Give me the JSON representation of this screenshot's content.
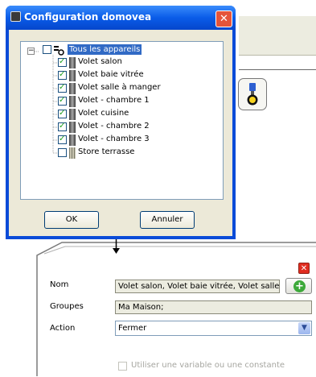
{
  "dialog": {
    "title": "Configuration domovea",
    "tree": {
      "root": {
        "label": "Tous les appareils",
        "checked": false
      },
      "items": [
        {
          "label": "Volet salon",
          "checked": true,
          "icon": "shutter-icon"
        },
        {
          "label": "Volet baie vitrée",
          "checked": true,
          "icon": "shutter-icon"
        },
        {
          "label": "Volet salle à manger",
          "checked": true,
          "icon": "shutter-icon"
        },
        {
          "label": "Volet - chambre 1",
          "checked": true,
          "icon": "shutter-icon"
        },
        {
          "label": "Volet cuisine",
          "checked": true,
          "icon": "shutter-icon"
        },
        {
          "label": "Volet - chambre 2",
          "checked": true,
          "icon": "shutter-icon"
        },
        {
          "label": "Volet - chambre 3",
          "checked": true,
          "icon": "shutter-icon"
        },
        {
          "label": "Store terrasse",
          "checked": false,
          "icon": "blind-icon"
        }
      ]
    },
    "ok_label": "OK",
    "cancel_label": "Annuler"
  },
  "form": {
    "nom_label": "Nom",
    "nom_value": "Volet salon, Volet baie vitrée, Volet salle à",
    "groupes_label": "Groupes",
    "groupes_value": "Ma Maison;",
    "action_label": "Action",
    "action_value": "Fermer",
    "constant_label": "Utiliser une variable ou une constante",
    "constant_checked": false
  },
  "colors": {
    "titlebar": "#0a5ce8",
    "dialog_face": "#ece9d8",
    "selection": "#316ac5",
    "close_red": "#e02d20",
    "add_green": "#3da93a"
  }
}
